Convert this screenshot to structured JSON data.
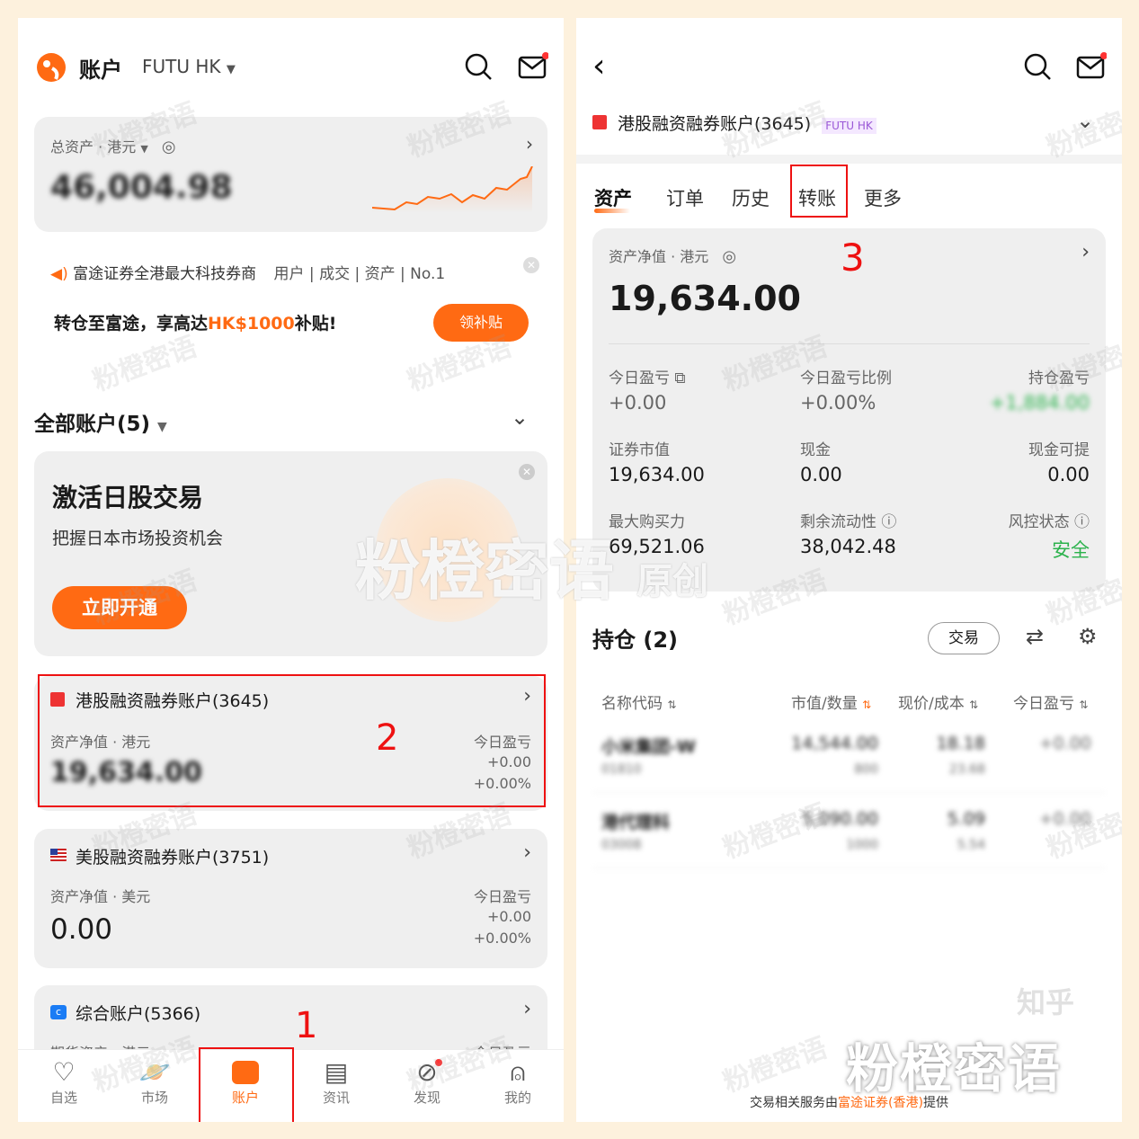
{
  "left": {
    "header": {
      "title": "账户",
      "broker": "FUTU HK"
    },
    "total": {
      "label": "总资产 · 港元",
      "value": "46,004.98"
    },
    "notice": {
      "text": "富途证券全港最大科技券商",
      "tags": "用户 | 成交 | 资产 | No.1"
    },
    "promo": {
      "text1": "转仓至富途，享高达",
      "amount": "HK$1000",
      "text2": "补贴!",
      "button": "领补贴"
    },
    "all_accounts": {
      "label": "全部账户(5)"
    },
    "japan": {
      "title": "激活日股交易",
      "subtitle": "把握日本市场投资机会",
      "button": "立即开通"
    },
    "accounts": [
      {
        "name": "港股融资融券账户(3645)",
        "value_label": "资产净值 · 港元",
        "value": "19,634.00",
        "pl_label": "今日盈亏",
        "pl": "+0.00",
        "pl_pct": "+0.00%"
      },
      {
        "name": "美股融资融券账户(3751)",
        "value_label": "资产净值 · 美元",
        "value": "0.00",
        "pl_label": "今日盈亏",
        "pl": "+0.00",
        "pl_pct": "+0.00%"
      },
      {
        "name": "综合账户(5366)",
        "value_label": "期货资产 · 港元",
        "pl_label": "今日盈亏"
      }
    ],
    "nav": [
      {
        "label": "自选"
      },
      {
        "label": "市场"
      },
      {
        "label": "账户"
      },
      {
        "label": "资讯"
      },
      {
        "label": "发现"
      },
      {
        "label": "我的"
      }
    ]
  },
  "right": {
    "account": {
      "name": "港股融资融券账户(3645)",
      "badge": "FUTU HK"
    },
    "tabs": [
      "资产",
      "订单",
      "历史",
      "转账",
      "更多"
    ],
    "net": {
      "label": "资产净值 · 港元",
      "value": "19,634.00"
    },
    "stats": {
      "today_pl_label": "今日盈亏",
      "today_pl": "+0.00",
      "today_pct_label": "今日盈亏比例",
      "today_pct": "+0.00%",
      "hold_pl_label": "持仓盈亏",
      "hold_pl": "+1,884.00",
      "mkt_label": "证券市值",
      "mkt": "19,634.00",
      "cash_label": "现金",
      "cash": "0.00",
      "withdraw_label": "现金可提",
      "withdraw": "0.00",
      "buy_label": "最大购买力",
      "buy": "69,521.06",
      "liq_label": "剩余流动性",
      "liq": "38,042.48",
      "risk_label": "风控状态",
      "risk": "安全"
    },
    "positions": {
      "title": "持仓 (2)",
      "trade": "交易",
      "headers": [
        "名称代码",
        "市值/数量",
        "现价/成本",
        "今日盈亏"
      ],
      "rows": [
        {
          "name": "小米集团-W",
          "code": "01810",
          "value": "14,544.00",
          "qty": "800",
          "price": "18.18",
          "cost": "23.68",
          "pl": "+0.00"
        },
        {
          "name": "港代理科",
          "code": "03008",
          "value": "5,090.00",
          "qty": "1000",
          "price": "5.09",
          "cost": "5.54",
          "pl": "+0.00"
        }
      ]
    },
    "footer": {
      "prefix": "交易相关服务由",
      "brand": "富途证券(香港)",
      "suffix": "提供"
    }
  },
  "annotations": {
    "n1": "1",
    "n2": "2",
    "n3": "3"
  },
  "watermarks": {
    "small": "粉橙密语",
    "center": "粉橙密语",
    "center_sub": "原创",
    "corner": "粉橙密语",
    "zhihu": "知乎"
  }
}
